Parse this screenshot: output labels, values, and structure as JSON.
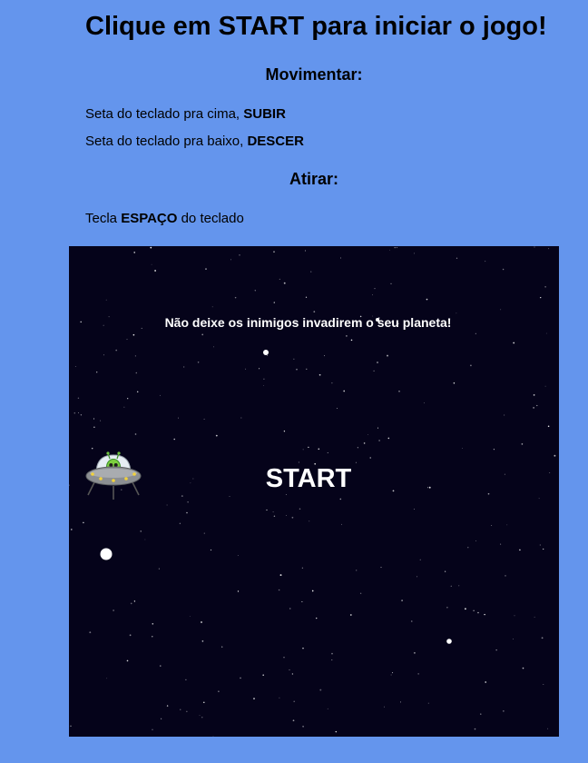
{
  "header": {
    "title": "Clique em START para iniciar o jogo!"
  },
  "instructions": {
    "move_heading": "Movimentar:",
    "up_text": "Seta do teclado pra cima, ",
    "up_key": "SUBIR",
    "down_text": "Seta do teclado pra baixo, ",
    "down_key": "DESCER",
    "shoot_heading": "Atirar:",
    "shoot_prefix": "Tecla ",
    "shoot_key": "ESPAÇO",
    "shoot_suffix": " do teclado"
  },
  "game": {
    "message": "Não deixe os inimigos invadirem o seu planeta!",
    "start_label": "START",
    "player_icon": "ufo-alien-icon",
    "colors": {
      "page_background": "#6495ed",
      "game_background": "#05031a",
      "text": "#ffffff"
    }
  }
}
